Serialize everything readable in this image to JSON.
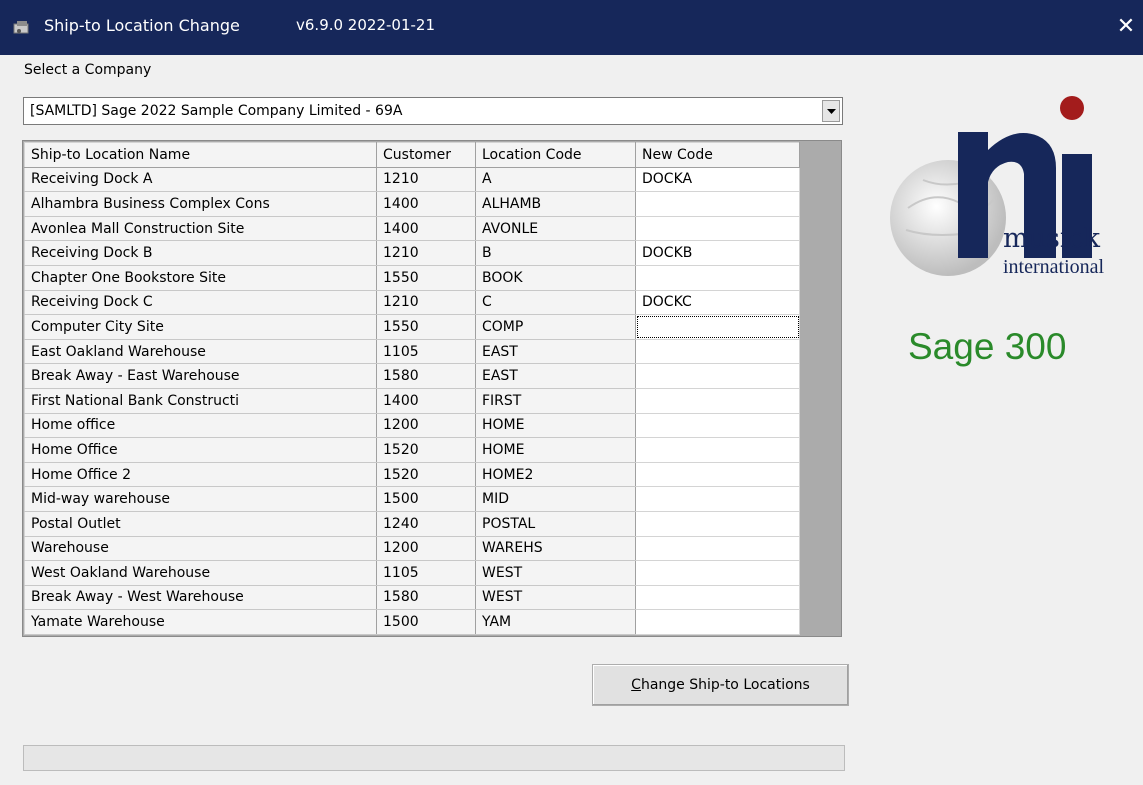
{
  "window": {
    "title": "Ship-to Location Change",
    "version": "v6.9.0  2022-01-21",
    "close_icon": "✕"
  },
  "company": {
    "label": "Select a Company",
    "selected": "[SAMLTD] Sage 2022 Sample Company Limited  - 69A"
  },
  "grid": {
    "columns": [
      "Ship-to Location Name",
      "Customer",
      "Location Code",
      "New Code"
    ],
    "rows": [
      [
        "Receiving Dock A",
        "1210",
        "A",
        "DOCKA"
      ],
      [
        "Alhambra Business Complex Cons",
        "1400",
        "ALHAMB",
        ""
      ],
      [
        "Avonlea Mall Construction Site",
        "1400",
        "AVONLE",
        ""
      ],
      [
        "Receiving Dock B",
        "1210",
        "B",
        "DOCKB"
      ],
      [
        "Chapter One Bookstore Site",
        "1550",
        "BOOK",
        ""
      ],
      [
        "Receiving Dock C",
        "1210",
        "C",
        "DOCKC"
      ],
      [
        "Computer City Site",
        "1550",
        "COMP",
        ""
      ],
      [
        "East Oakland Warehouse",
        "1105",
        "EAST",
        ""
      ],
      [
        "Break Away - East Warehouse",
        "1580",
        "EAST",
        ""
      ],
      [
        "First National Bank Constructi",
        "1400",
        "FIRST",
        ""
      ],
      [
        "Home office",
        "1200",
        "HOME",
        ""
      ],
      [
        "Home Office",
        "1520",
        "HOME",
        ""
      ],
      [
        "Home Office 2",
        "1520",
        "HOME2",
        ""
      ],
      [
        "Mid-way warehouse",
        "1500",
        "MID",
        ""
      ],
      [
        "Postal Outlet",
        "1240",
        "POSTAL",
        ""
      ],
      [
        "Warehouse",
        "1200",
        "WAREHS",
        ""
      ],
      [
        "West Oakland Warehouse",
        "1105",
        "WEST",
        ""
      ],
      [
        "Break Away - West Warehouse",
        "1580",
        "WEST",
        ""
      ],
      [
        "Yamate Warehouse",
        "1500",
        "YAM",
        ""
      ]
    ],
    "focused_row": 6
  },
  "action": {
    "mnemonic": "C",
    "label_rest": "hange Ship-to Locations"
  },
  "branding": {
    "logo_word1": "musick",
    "logo_word2": "international",
    "product": "Sage 300"
  },
  "colors": {
    "titlebar": "#16275a",
    "logo_navy": "#16275a",
    "logo_dot": "#a31c1c",
    "product_green": "#2a8a2a"
  }
}
